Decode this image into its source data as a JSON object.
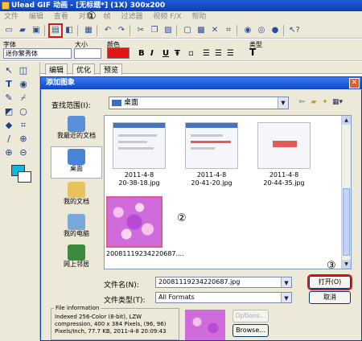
{
  "app": {
    "title": "Ulead GIF 动画 - [无标题*] (1X) 300x200",
    "menu": [
      "文件",
      "编辑",
      "查看",
      "对象",
      "帧",
      "过滤器",
      "视频 F/X",
      "帮助"
    ]
  },
  "annotations": {
    "one": "①",
    "two": "②",
    "three": "③"
  },
  "props": {
    "font_label": "字体",
    "size_label": "大小",
    "color_label": "颜色",
    "type_label": "类型",
    "font_value": "迷你繁秀体",
    "color": "#e01717",
    "bold": "B",
    "italic": "I",
    "underline": "U",
    "type_icon": "T"
  },
  "tabs": [
    "编辑",
    "优化",
    "预览"
  ],
  "dialog": {
    "title": "添加图象",
    "lookin_label": "查找范围(I):",
    "lookin_value": "桌面",
    "places": [
      "我最近的文档",
      "桌面",
      "我的文档",
      "我的电脑",
      "网上邻居"
    ],
    "files": [
      {
        "name1": "2011-4-8",
        "name2": "20-38-18.jpg"
      },
      {
        "name1": "2011-4-8",
        "name2": "20-41-20.jpg"
      },
      {
        "name1": "2011-4-8",
        "name2": "20-44-35.jpg"
      },
      {
        "name1": "20081119234220687....",
        "name2": ""
      }
    ],
    "filename_label": "文件名(N):",
    "filename_value": "20081119234220687.jpg",
    "filetype_label": "文件类型(T):",
    "filetype_value": "All Formats",
    "open_button": "打开(O)",
    "cancel_button": "取消",
    "info_title": "File information",
    "info_lines": [
      "Indexed 256-Color (8-bit), LZW",
      "compression, 400 x 384 Pixels, (96, 96)",
      "Pixels/Inch, 77.7 KB, 2011-4-8 20:09:43"
    ],
    "options_button": "Options...",
    "browse_button": "Browse..."
  }
}
